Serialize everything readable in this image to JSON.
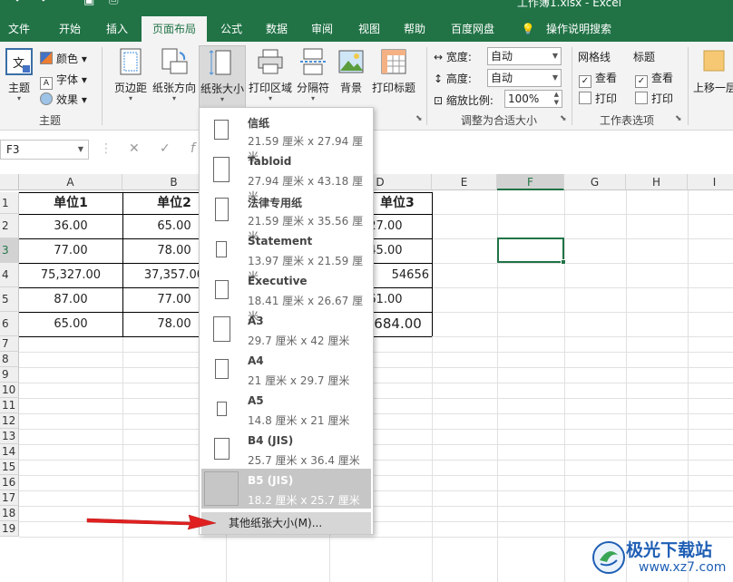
{
  "window": {
    "title": "工作簿1.xlsx  -  Excel"
  },
  "tabs": [
    {
      "label": "文件"
    },
    {
      "label": "开始"
    },
    {
      "label": "插入"
    },
    {
      "label": "页面布局"
    },
    {
      "label": "公式"
    },
    {
      "label": "数据"
    },
    {
      "label": "审阅"
    },
    {
      "label": "视图"
    },
    {
      "label": "帮助"
    },
    {
      "label": "百度网盘"
    },
    {
      "label": "操作说明搜索"
    }
  ],
  "ribbon": {
    "theme": {
      "label": "主题",
      "colors": "颜色",
      "fonts": "字体",
      "effects": "效果",
      "group": "主题"
    },
    "margins": "页边距",
    "orientation": "纸张方向",
    "size": "纸张大小",
    "print_area": "打印区域",
    "breaks": "分隔符",
    "background": "背景",
    "print_titles": "打印标题",
    "width_label": "宽度:",
    "width_value": "自动",
    "height_label": "高度:",
    "height_value": "自动",
    "scale_label": "缩放比例:",
    "scale_value": "100%",
    "scale_group": "调整为合适大小",
    "gridlines": "网格线",
    "headings": "标题",
    "view1": "查看",
    "print1": "打印",
    "view2": "查看",
    "print2": "打印",
    "options_group": "工作表选项",
    "bring_forward": "上移一层"
  },
  "formula_bar": {
    "name_box": "F3",
    "cancel": "✕",
    "enter": "✓"
  },
  "sheet": {
    "columns": [
      "A",
      "B",
      "C",
      "D",
      "E",
      "F",
      "G",
      "H",
      "I"
    ],
    "rows": [
      "1",
      "2",
      "3",
      "4",
      "5",
      "6",
      "7",
      "8",
      "9",
      "10",
      "11",
      "12",
      "13",
      "14",
      "15",
      "16",
      "17",
      "18",
      "19"
    ],
    "header_row": [
      "单位1",
      "单位2",
      "单位3"
    ],
    "a": [
      "36.00",
      "77.00",
      "75,327.00",
      "87.00",
      "65.00"
    ],
    "b": [
      "65.00",
      "78.00",
      "37,357.00",
      "77.00",
      "78.00"
    ],
    "d": [
      "727.00",
      "745.00",
      "54656",
      "561.00",
      "5,684.00"
    ]
  },
  "paper_menu": {
    "items": [
      {
        "name": "信纸",
        "dim": "21.59 厘米 x 27.94 厘米"
      },
      {
        "name": "Tabloid",
        "dim": "27.94 厘米 x 43.18 厘米"
      },
      {
        "name": "法律专用纸",
        "dim": "21.59 厘米 x 35.56 厘米"
      },
      {
        "name": "Statement",
        "dim": "13.97 厘米 x 21.59 厘米"
      },
      {
        "name": "Executive",
        "dim": "18.41 厘米 x 26.67 厘米"
      },
      {
        "name": "A3",
        "dim": "29.7 厘米 x 42 厘米"
      },
      {
        "name": "A4",
        "dim": "21 厘米 x 29.7 厘米"
      },
      {
        "name": "A5",
        "dim": "14.8 厘米 x 21 厘米"
      },
      {
        "name": "B4 (JIS)",
        "dim": "25.7 厘米 x 36.4 厘米"
      },
      {
        "name": "B5 (JIS)",
        "dim": "18.2 厘米 x 25.7 厘米"
      }
    ],
    "more": "其他纸张大小(M)..."
  },
  "watermark": {
    "line1": "极光下载站",
    "line2": "www.xz7.com"
  },
  "colors": {
    "excel_green": "#217346",
    "arrow_red": "#e02020",
    "watermark_blue": "#1f5fb5"
  }
}
